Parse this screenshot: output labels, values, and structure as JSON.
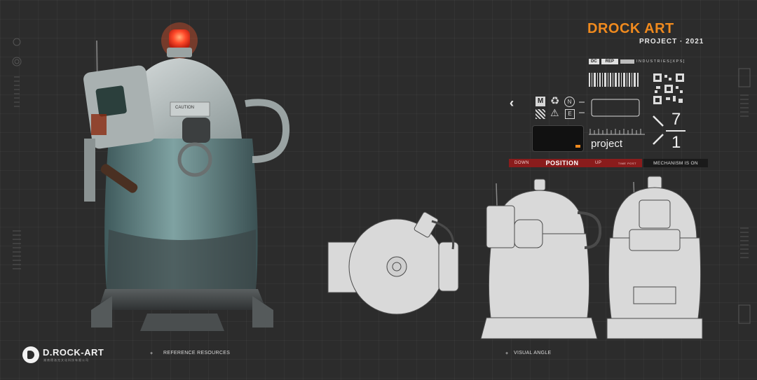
{
  "brand": {
    "title": "DROCK ART",
    "subtitle": "PROJECT · 2021",
    "accent_color": "#f08a1e"
  },
  "header_strip": {
    "tag_left": "DC",
    "tag_mid": "REP",
    "industries": "INDUSTRIES[XPS]"
  },
  "icons": {
    "chevrons": "triple-chevron-left-icon",
    "m_badge": "M",
    "recycle": "recycle-icon",
    "n_badge": "N",
    "qr_small": "qr-code-icon",
    "warning": "warning-triangle-icon",
    "e_badge": "E"
  },
  "panel": {
    "project_word": "project",
    "fraction_top": "7",
    "fraction_bottom": "1"
  },
  "position_bar": {
    "down": "DOWN",
    "position": "POSITION",
    "up": "UP",
    "tiny": "TIME POST",
    "mechanism": "MECHANISM IS ON",
    "bar_color": "#8a1c1c"
  },
  "footer": {
    "logo": "D.ROCK-ART",
    "logo_sub": "湖南德洛克文化科技有限公司",
    "reference": "REFERENCE RESOURCES",
    "visual": "VISUAL ANGLE"
  },
  "colors": {
    "beacon": "#ff4a2a",
    "tank_body": "#6f8f8f",
    "blueprint_fill": "#d9d9d9"
  }
}
